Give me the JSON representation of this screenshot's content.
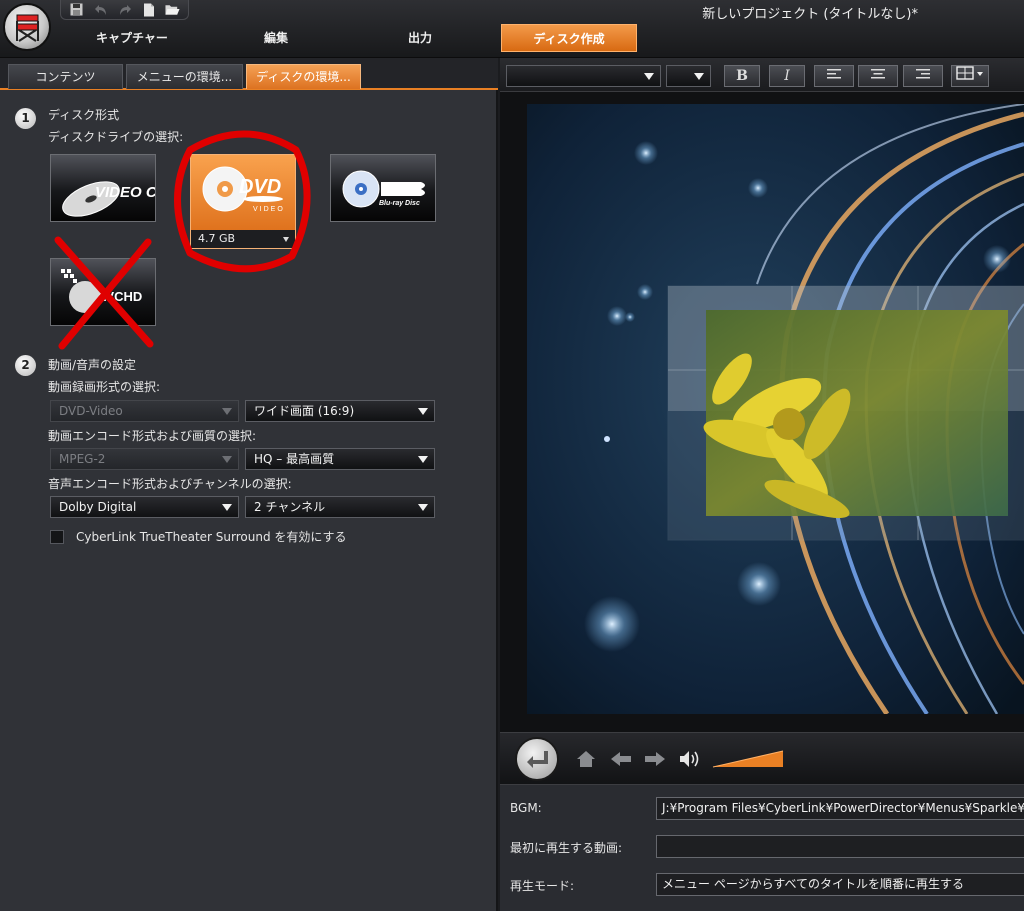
{
  "window": {
    "title": "新しいプロジェクト (タイトルなし)*"
  },
  "quick_toolbar": {
    "icons": [
      "save-icon",
      "undo-icon",
      "redo-icon",
      "new-file-icon",
      "open-folder-icon"
    ]
  },
  "main_tabs": [
    {
      "label": "キャプチャー",
      "active": false
    },
    {
      "label": "編集",
      "active": false
    },
    {
      "label": "出力",
      "active": false
    },
    {
      "label": "ディスク作成",
      "active": true
    }
  ],
  "sub_tabs": [
    {
      "label": "コンテンツ",
      "active": false
    },
    {
      "label": "メニューの環境...",
      "active": false
    },
    {
      "label": "ディスクの環境...",
      "active": true
    }
  ],
  "disc_format": {
    "number": "1",
    "title": "ディスク形式",
    "drive_label": "ディスクドライブの選択:",
    "discs": [
      {
        "name": "VIDEO CD",
        "selected": false
      },
      {
        "name": "DVD",
        "sub": "VIDEO",
        "selected": true,
        "capacity": "4.7 GB"
      },
      {
        "name": "Blu-ray Disc",
        "selected": false
      },
      {
        "name": "AVCHD",
        "selected": false
      }
    ]
  },
  "av_settings": {
    "number": "2",
    "title": "動画/音声の設定",
    "video_format_label": "動画録画形式の選択:",
    "video_format_value": "DVD-Video",
    "aspect_value": "ワイド画面 (16:9)",
    "encode_label": "動画エンコード形式および画質の選択:",
    "encode_value": "MPEG-2",
    "quality_value": "HQ – 最高画質",
    "audio_label": "音声エンコード形式およびチャンネルの選択:",
    "audio_value": "Dolby Digital",
    "channel_value": "2 チャンネル",
    "surround_label": "CyberLink TrueTheater Surround を有効にする",
    "surround_checked": false
  },
  "editor_toolbar": {
    "bold": "B",
    "italic": "I",
    "icons": [
      "align-left-icon",
      "align-center-icon",
      "align-right-icon",
      "grid-layout-icon"
    ]
  },
  "playback": {
    "icons": [
      "back-circle-icon",
      "home-icon",
      "prev-arrow-icon",
      "next-arrow-icon",
      "volume-icon"
    ]
  },
  "properties": {
    "bgm_label": "BGM:",
    "bgm_value": "J:¥Program Files¥CyberLink¥PowerDirector¥Menus¥Sparkle¥Au",
    "first_play_label": "最初に再生する動画:",
    "first_play_value": "",
    "play_mode_label": "再生モード:",
    "play_mode_value": "メニュー ページからすべてのタイトルを順番に再生する"
  },
  "colors": {
    "accent": "#e98024",
    "annotation_red": "#e00000"
  }
}
